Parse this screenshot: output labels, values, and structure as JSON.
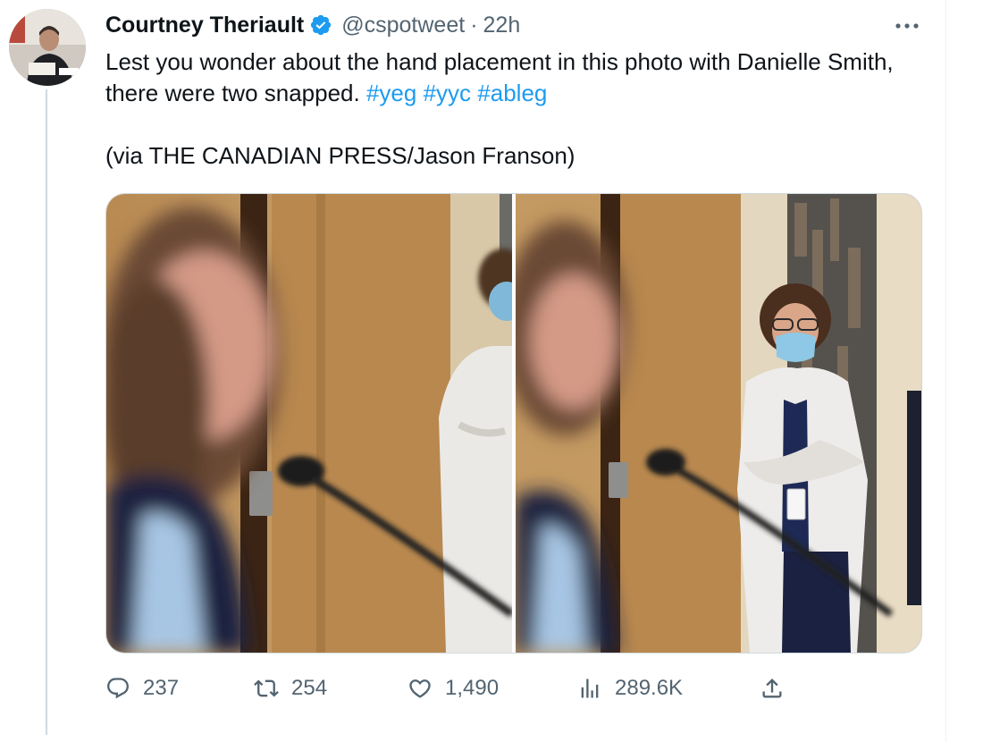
{
  "tweet": {
    "author_name": "Courtney Theriault",
    "handle": "@cspotweet",
    "separator": "·",
    "time": "22h",
    "text_line1_prefix": "Lest you wonder about the hand placement in this photo with Danielle Smith, there were two snapped. ",
    "hashtags": [
      "#yeg",
      "#yyc",
      "#ableg"
    ],
    "credit": "(via THE CANADIAN PRESS/Jason Franson)"
  },
  "icons": {
    "verified": "verified-badge-icon",
    "more": "more-dots-icon",
    "reply": "reply-icon",
    "retweet": "retweet-icon",
    "like": "heart-icon",
    "views": "views-icon",
    "share": "share-icon"
  },
  "actions": {
    "reply_count": "237",
    "retweet_count": "254",
    "like_count": "1,490",
    "view_count": "289.6K"
  },
  "colors": {
    "link": "#1d9bf0",
    "muted": "#536471",
    "verified": "#1d9bf0"
  }
}
